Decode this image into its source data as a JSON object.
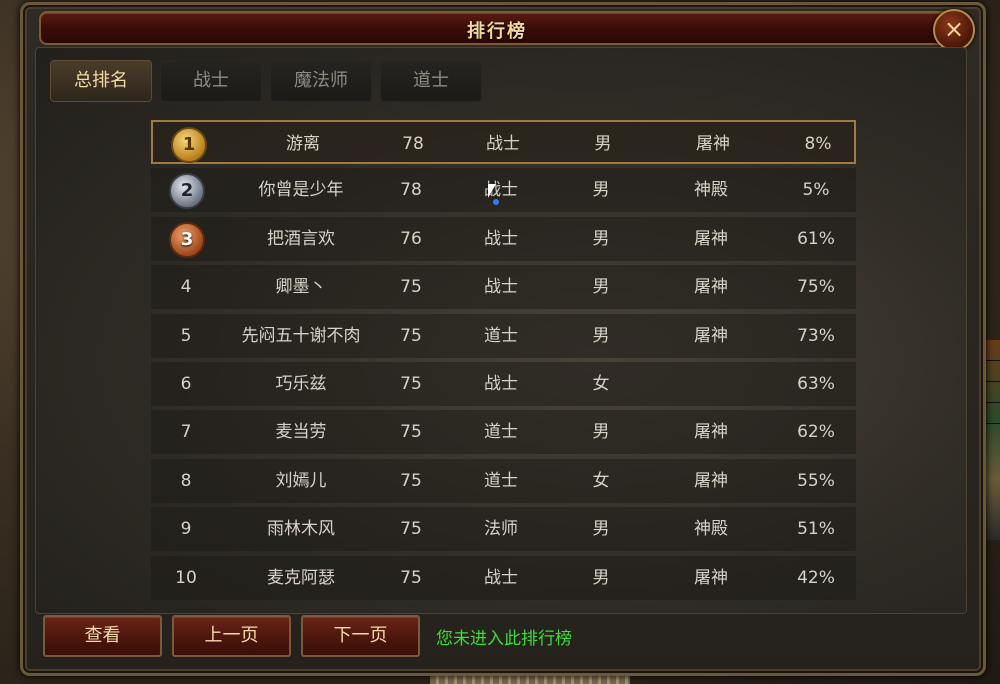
{
  "window": {
    "title": "排行榜",
    "close_label": "×"
  },
  "tabs": [
    {
      "label": "总排名",
      "active": true
    },
    {
      "label": "战士",
      "active": false
    },
    {
      "label": "魔法师",
      "active": false
    },
    {
      "label": "道士",
      "active": false
    }
  ],
  "rows": [
    {
      "rank": "1",
      "medal": "gold",
      "name": "游离",
      "level": "78",
      "class": "战士",
      "gender": "男",
      "guild": "屠神",
      "pct": "8%"
    },
    {
      "rank": "2",
      "medal": "silver",
      "name": "你曾是少年",
      "level": "78",
      "class": "战士",
      "gender": "男",
      "guild": "神殿",
      "pct": "5%"
    },
    {
      "rank": "3",
      "medal": "bronze",
      "name": "把酒言欢",
      "level": "76",
      "class": "战士",
      "gender": "男",
      "guild": "屠神",
      "pct": "61%"
    },
    {
      "rank": "4",
      "medal": "",
      "name": "卿墨丶",
      "level": "75",
      "class": "战士",
      "gender": "男",
      "guild": "屠神",
      "pct": "75%"
    },
    {
      "rank": "5",
      "medal": "",
      "name": "先闷五十谢不肉",
      "level": "75",
      "class": "道士",
      "gender": "男",
      "guild": "屠神",
      "pct": "73%"
    },
    {
      "rank": "6",
      "medal": "",
      "name": "巧乐兹",
      "level": "75",
      "class": "战士",
      "gender": "女",
      "guild": "",
      "pct": "63%"
    },
    {
      "rank": "7",
      "medal": "",
      "name": "麦当劳",
      "level": "75",
      "class": "道士",
      "gender": "男",
      "guild": "屠神",
      "pct": "62%"
    },
    {
      "rank": "8",
      "medal": "",
      "name": "刘嫣儿",
      "level": "75",
      "class": "道士",
      "gender": "女",
      "guild": "屠神",
      "pct": "55%"
    },
    {
      "rank": "9",
      "medal": "",
      "name": "雨林木风",
      "level": "75",
      "class": "法师",
      "gender": "男",
      "guild": "神殿",
      "pct": "51%"
    },
    {
      "rank": "10",
      "medal": "",
      "name": "麦克阿瑟",
      "level": "75",
      "class": "战士",
      "gender": "男",
      "guild": "屠神",
      "pct": "42%"
    }
  ],
  "selected_row": 0,
  "buttons": {
    "view": "查看",
    "prev": "上一页",
    "next": "下一页"
  },
  "status_text": "您未进入此排行榜",
  "colors": {
    "status": "#3fdc3a",
    "title_bar": "#3a0d08",
    "selected_border": "#a07a40"
  }
}
